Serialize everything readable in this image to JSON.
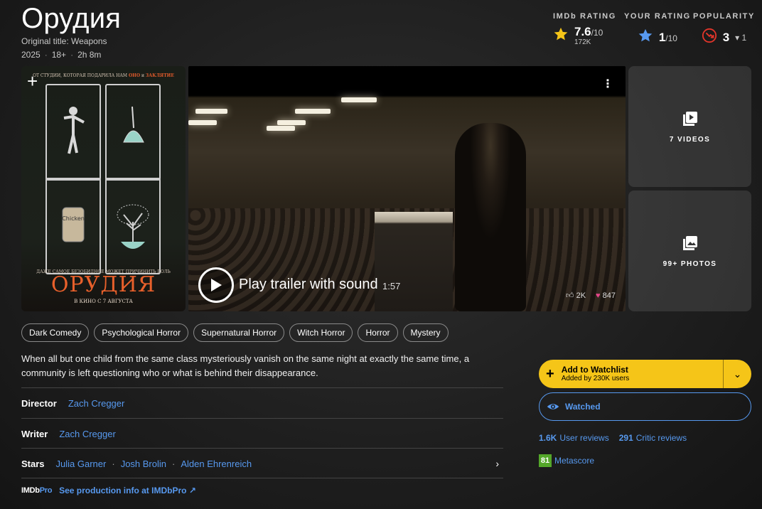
{
  "title": "Орудия",
  "original_title": "Original title: Weapons",
  "meta": {
    "year": "2025",
    "rating": "18+",
    "runtime": "2h 8m"
  },
  "imdb_rating": {
    "label": "IMDb RATING",
    "score": "7.6",
    "out_of": "/10",
    "votes": "172K"
  },
  "your_rating": {
    "label": "YOUR RATING",
    "score": "1",
    "out_of": "/10"
  },
  "popularity": {
    "label": "POPULARITY",
    "rank": "3",
    "change": "1"
  },
  "poster": {
    "top_line_a": "ОТ СТУДИИ, КОТОРАЯ ПОДАРИЛА НАМ",
    "top_line_b": "ОНО",
    "top_line_c": "и",
    "top_line_d": "ЗАКЛЯТИЕ",
    "tagline": "ДАЖЕ САМОЕ БЕЗОБИДНОЕ МОЖЕТ ПРИЧИНИТЬ БОЛЬ",
    "name": "ОРУДИЯ",
    "release": "В КИНО С 7 АВГУСТА",
    "can_label": "Chicken"
  },
  "trailer": {
    "label": "Play trailer with sound",
    "duration": "1:57",
    "likes": "2K",
    "reactions": "847"
  },
  "tiles": {
    "videos": "7 VIDEOS",
    "photos": "99+ PHOTOS"
  },
  "genres": [
    "Dark Comedy",
    "Psychological Horror",
    "Supernatural Horror",
    "Witch Horror",
    "Horror",
    "Mystery"
  ],
  "plot": "When all but one child from the same class mysteriously vanish on the same night at exactly the same time, a community is left questioning who or what is behind their disappearance.",
  "credits": {
    "director_label": "Director",
    "director": "Zach Cregger",
    "writer_label": "Writer",
    "writer": "Zach Cregger",
    "stars_label": "Stars",
    "stars": [
      "Julia Garner",
      "Josh Brolin",
      "Alden Ehrenreich"
    ]
  },
  "pro": {
    "logo_a": "IMDb",
    "logo_b": "Pro",
    "link": "See production info at IMDbPro"
  },
  "watchlist": {
    "title": "Add to Watchlist",
    "sub": "Added by 230K users"
  },
  "watched": "Watched",
  "reviews": {
    "user_count": "1.6K",
    "user_label": "User reviews",
    "critic_count": "291",
    "critic_label": "Critic reviews"
  },
  "metascore": {
    "value": "81",
    "label": "Metascore"
  },
  "colors": {
    "accent_yellow": "#f5c518",
    "link_blue": "#5799ef",
    "metascore_green": "#54a72a"
  }
}
